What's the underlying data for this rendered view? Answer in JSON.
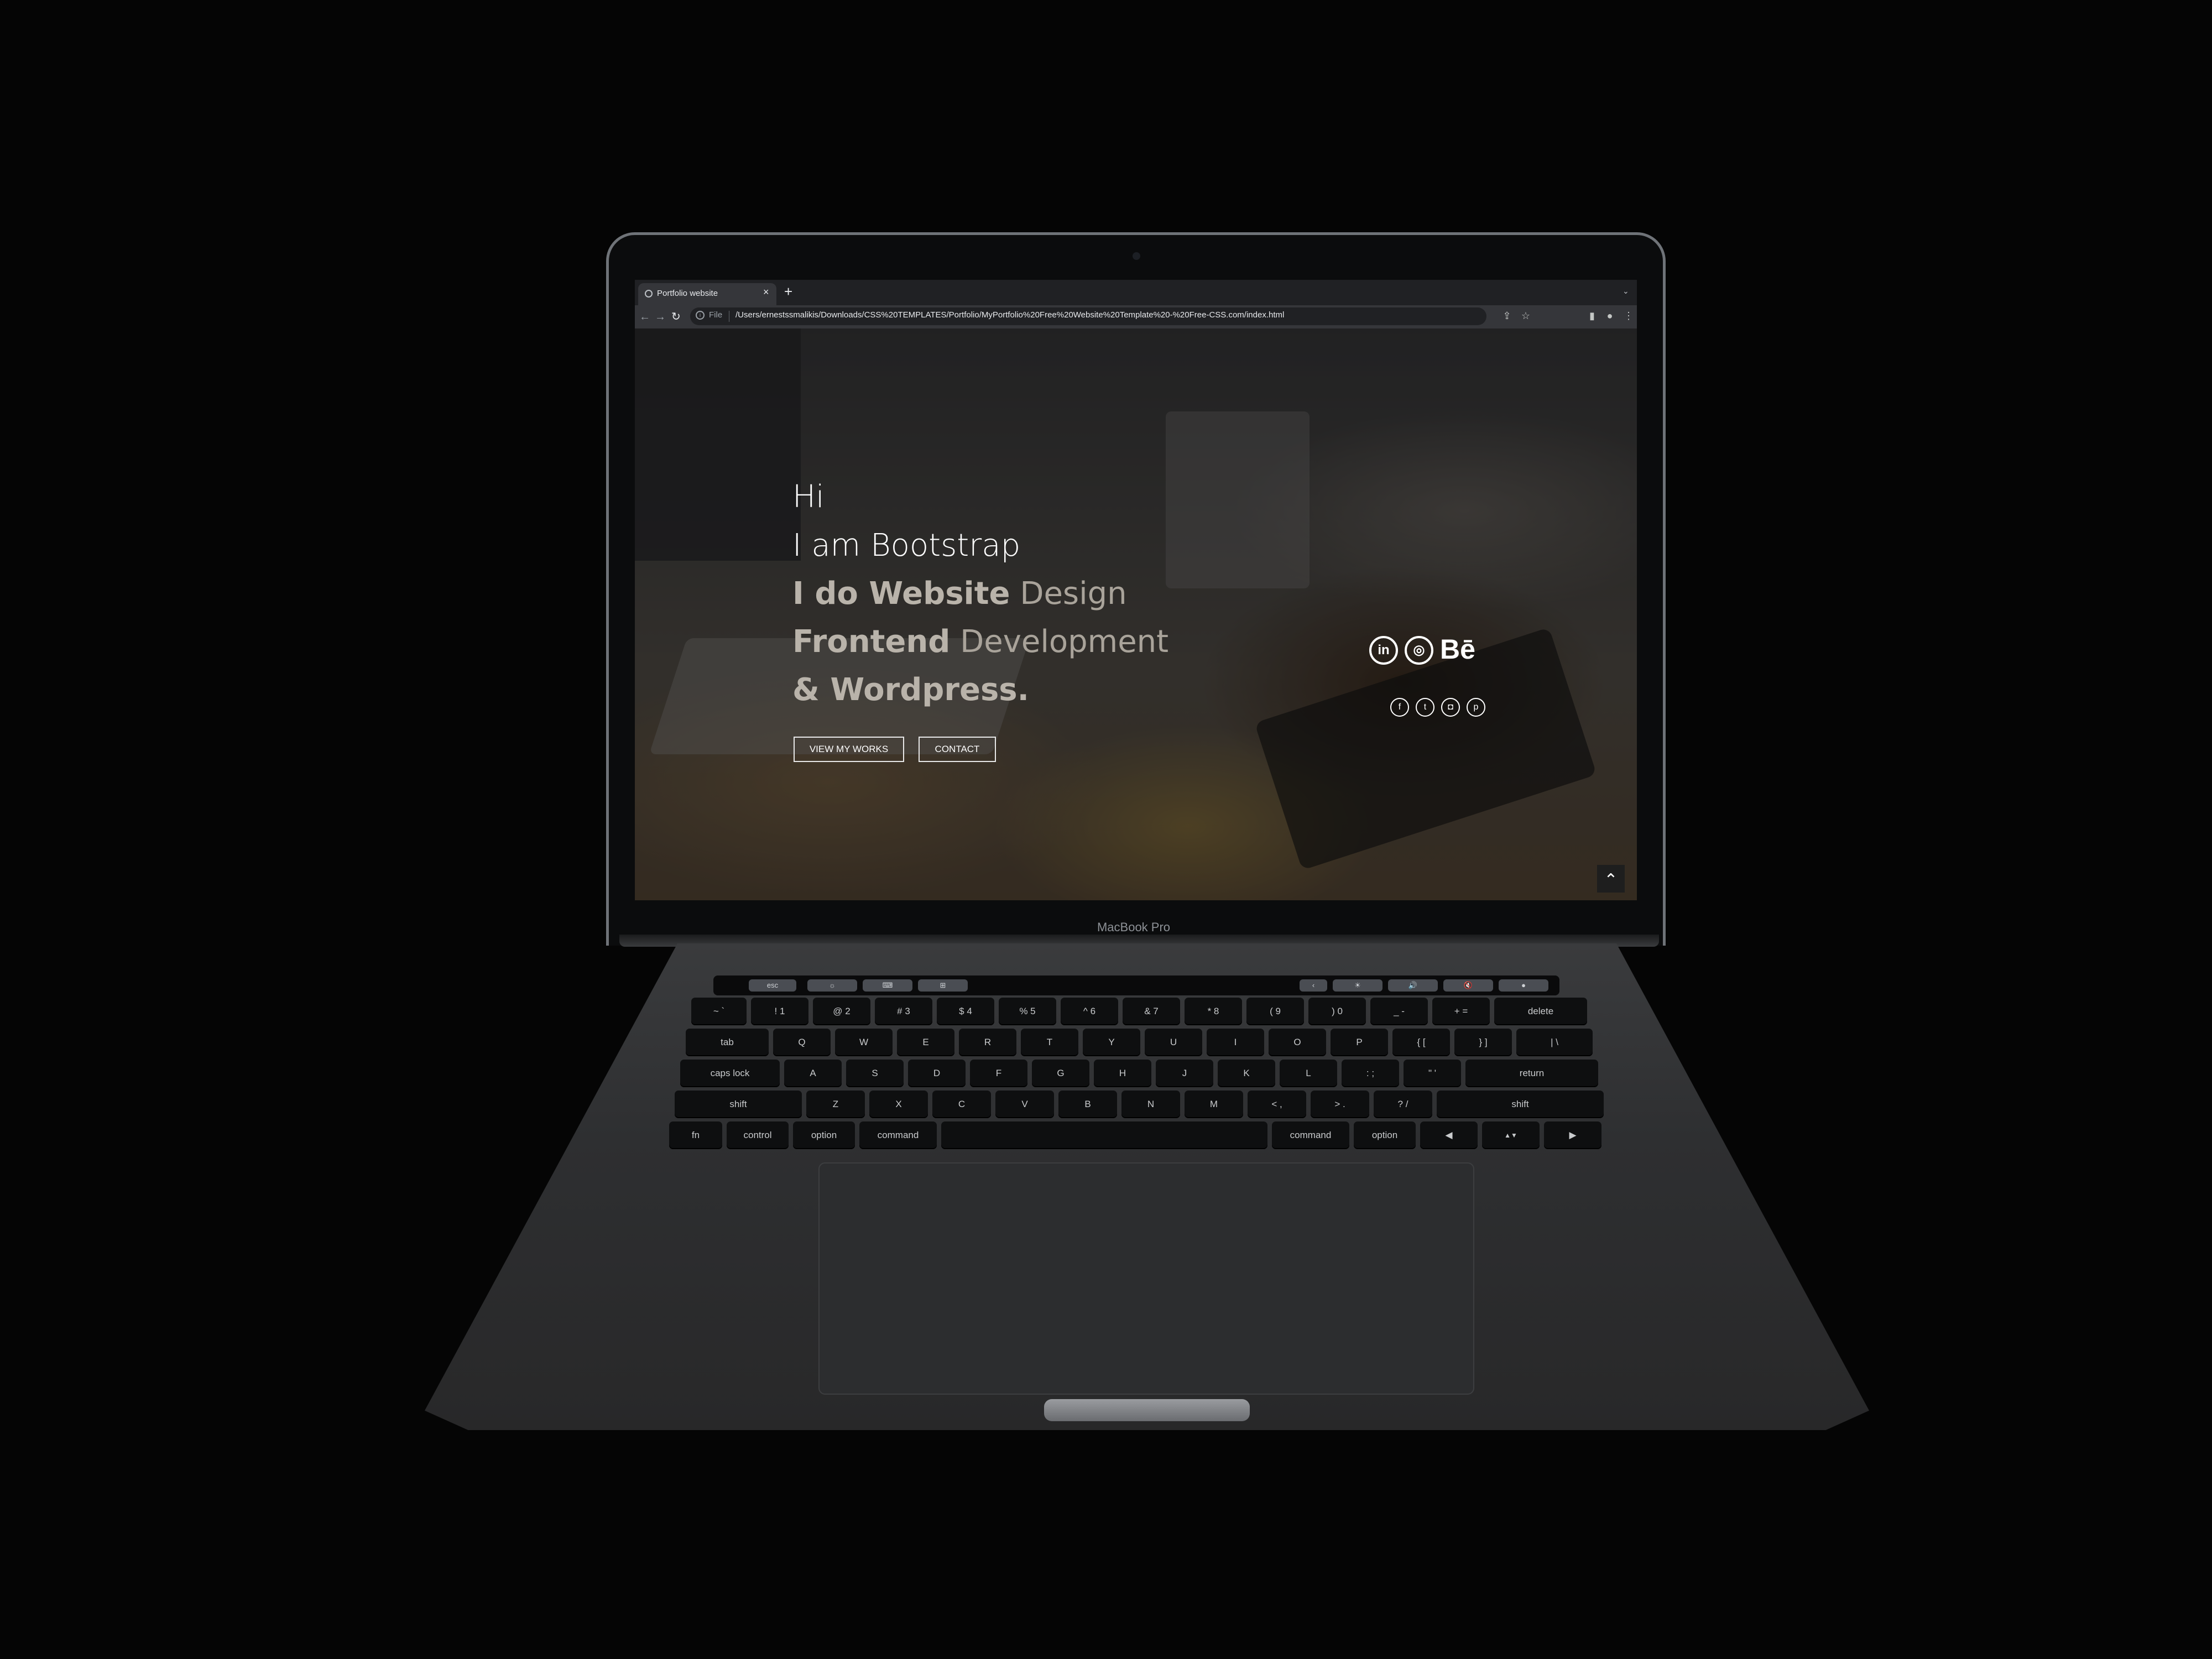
{
  "browser": {
    "tab_title": "Portfolio website",
    "tab_close": "×",
    "new_tab": "+",
    "tab_menu": "⌄",
    "nav_back": "←",
    "nav_forward": "→",
    "nav_reload": "↻",
    "omnibox_info": "i",
    "omnibox_scheme": "File",
    "url": "/Users/ernestssmalikis/Downloads/CSS%20TEMPLATES/Portfolio/MyPortfolio%20Free%20Website%20Template%20-%20Free-CSS.com/index.html",
    "toolbar_icons": [
      "share-icon",
      "star-icon",
      "sidepanel-icon",
      "profile-icon",
      "menu-icon"
    ]
  },
  "hero": {
    "line1": "Hi",
    "line2": "I am Bootstrap",
    "line3_bold": "I do Website",
    "line3_light": " Design",
    "line4_bold": "Frontend",
    "line4_light": " Development",
    "line5_bold": "& Wordpress.",
    "btn_works": "VIEW MY WORKS",
    "btn_contact": "CONTACT"
  },
  "social": {
    "linkedin": "in",
    "dribbble": "◎",
    "behance": "Bē",
    "facebook": "f",
    "twitter": "t",
    "instagram": "◘",
    "pinterest": "p"
  },
  "scroll_top": "⌃",
  "laptop": {
    "model_label": "MacBook Pro"
  },
  "touchbar": {
    "esc": "esc",
    "keys_left": [
      "☼",
      "⌨",
      "⊞"
    ],
    "keys_right": [
      "‹",
      "☀",
      "🔊",
      "🔇",
      "●"
    ]
  },
  "keyboard": {
    "row1": [
      "~ `",
      "! 1",
      "@ 2",
      "# 3",
      "$ 4",
      "% 5",
      "^ 6",
      "& 7",
      "* 8",
      "( 9",
      ") 0",
      "_ -",
      "+ =",
      "delete"
    ],
    "row2": [
      "tab",
      "Q",
      "W",
      "E",
      "R",
      "T",
      "Y",
      "U",
      "I",
      "O",
      "P",
      "{ [",
      "} ]",
      "| \\"
    ],
    "row3": [
      "caps lock",
      "A",
      "S",
      "D",
      "F",
      "G",
      "H",
      "J",
      "K",
      "L",
      ": ;",
      "\" '",
      "return"
    ],
    "row4": [
      "shift",
      "Z",
      "X",
      "C",
      "V",
      "B",
      "N",
      "M",
      "< ,",
      "> .",
      "? /",
      "shift"
    ],
    "row5": [
      "fn",
      "control",
      "option",
      "command",
      "",
      "command",
      "option",
      "◀",
      "▲▼",
      "▶"
    ]
  }
}
